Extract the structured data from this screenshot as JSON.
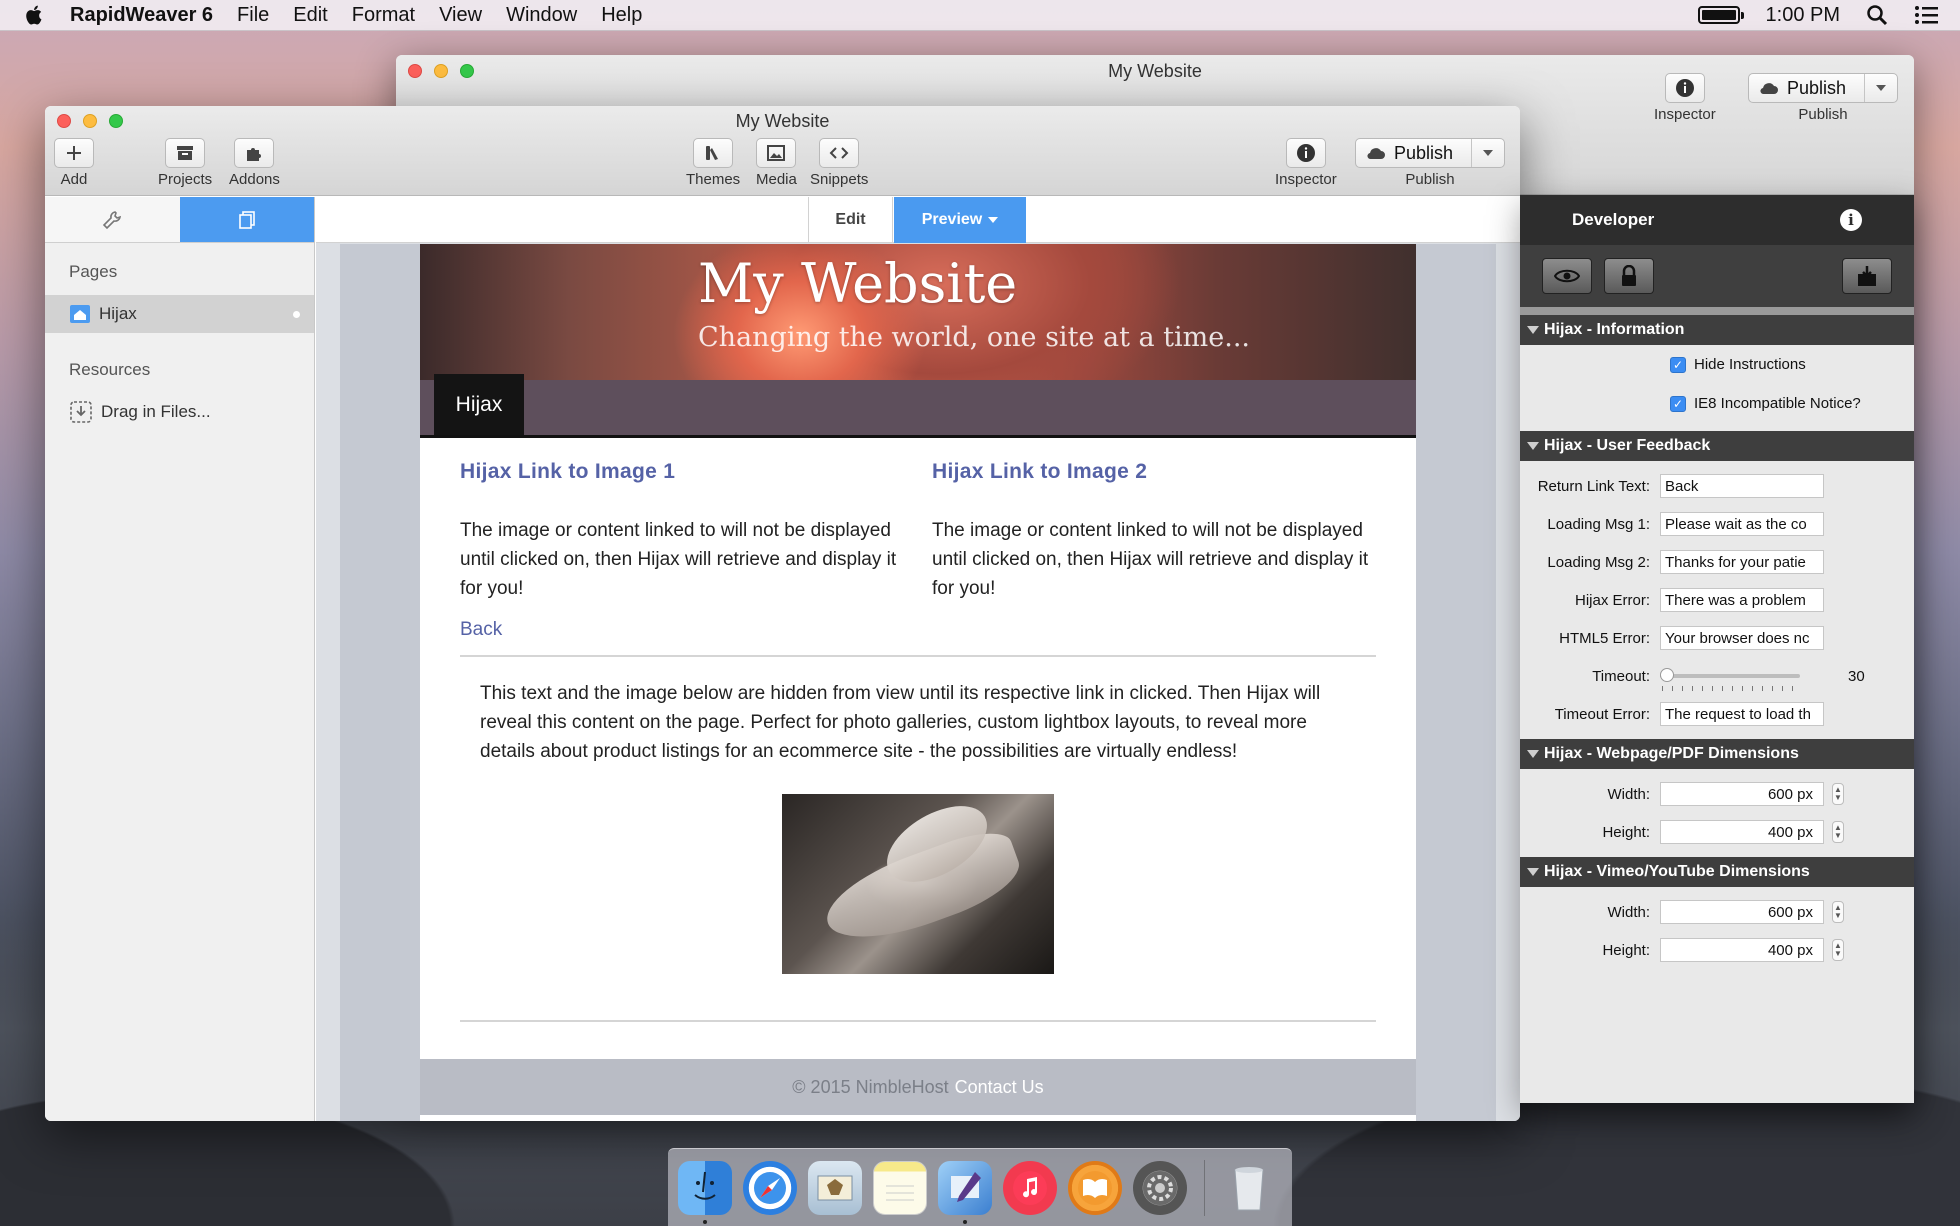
{
  "menubar": {
    "app_name": "RapidWeaver 6",
    "menus": [
      "File",
      "Edit",
      "Format",
      "View",
      "Window",
      "Help"
    ],
    "clock": "1:00 PM"
  },
  "back_window": {
    "title": "My Website",
    "inspector_label": "Inspector",
    "publish_label": "Publish",
    "publish_caption": "Publish"
  },
  "window": {
    "title": "My Website",
    "toolbar": {
      "add": "Add",
      "projects": "Projects",
      "addons": "Addons",
      "themes": "Themes",
      "media": "Media",
      "snippets": "Snippets",
      "inspector": "Inspector",
      "publish_button": "Publish",
      "publish_caption": "Publish"
    },
    "sidebar": {
      "pages_heading": "Pages",
      "pages": [
        {
          "label": "Hijax"
        }
      ],
      "resources_heading": "Resources",
      "resources": [
        {
          "label": "Drag in Files..."
        }
      ]
    },
    "mode": {
      "edit": "Edit",
      "preview": "Preview"
    }
  },
  "site": {
    "title": "My Website",
    "slogan": "Changing the world, one site at a time...",
    "nav": [
      "Hijax"
    ],
    "col1": {
      "heading": "Hijax Link to Image 1",
      "text": "The image or content linked to will not be displayed until clicked on, then Hijax will retrieve and display it for you!"
    },
    "col2": {
      "heading": "Hijax Link to Image 2",
      "text": "The image or content linked to will not be displayed until clicked on, then Hijax will retrieve and display it for you!"
    },
    "back_link": "Back",
    "hidden_text": "This text and the image below are hidden from view until its respective link in clicked. Then Hijax will reveal this content on the page. Perfect for photo galleries, custom lightbox layouts, to reveal more details about product listings for an ecommerce site - the possibilities are virtually endless!",
    "footer_copyright": "© 2015 NimbleHost",
    "footer_contact": "Contact Us"
  },
  "inspector": {
    "header": "Developer",
    "groups": {
      "information": {
        "title": "Hijax - Information",
        "hide_instructions": "Hide Instructions",
        "ie8_notice": "IE8 Incompatible Notice?"
      },
      "user_feedback": {
        "title": "Hijax - User Feedback",
        "return_link_label": "Return Link Text:",
        "return_link_value": "Back",
        "loading1_label": "Loading Msg 1:",
        "loading1_value": "Please wait as the co",
        "loading2_label": "Loading Msg 2:",
        "loading2_value": "Thanks for your patie",
        "hijax_error_label": "Hijax Error:",
        "hijax_error_value": "There was a problem",
        "html5_error_label": "HTML5 Error:",
        "html5_error_value": "Your browser does nc",
        "timeout_label": "Timeout:",
        "timeout_value": "30",
        "timeout_error_label": "Timeout Error:",
        "timeout_error_value": "The request to load th"
      },
      "webpage_dims": {
        "title": "Hijax - Webpage/PDF Dimensions",
        "width_label": "Width:",
        "width_value": "600 px",
        "height_label": "Height:",
        "height_value": "400 px"
      },
      "video_dims": {
        "title": "Hijax - Vimeo/YouTube Dimensions",
        "width_label": "Width:",
        "width_value": "600 px",
        "height_label": "Height:",
        "height_value": "400 px"
      }
    }
  },
  "dock": [
    "finder-icon",
    "safari-icon",
    "mail-icon",
    "notes-icon",
    "rapidweaver-icon",
    "itunes-icon",
    "ibooks-icon",
    "system-preferences-icon",
    "trash-icon"
  ]
}
